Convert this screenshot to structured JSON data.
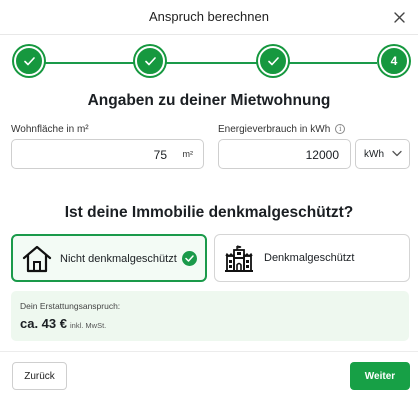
{
  "dialog": {
    "title": "Anspruch berechnen"
  },
  "stepper": {
    "steps": [
      {
        "state": "completed",
        "icon": "check-icon"
      },
      {
        "state": "completed",
        "icon": "check-icon"
      },
      {
        "state": "completed",
        "icon": "check-icon"
      },
      {
        "state": "current",
        "label": "4"
      }
    ],
    "accent_color": "#16983f"
  },
  "apartment_section": {
    "title": "Angaben zu deiner Mietwohnung",
    "living_area": {
      "label": "Wohnfläche in m²",
      "value": "75",
      "unit": "m²"
    },
    "energy_consumption": {
      "label": "Energieverbrauch in kWh",
      "info_icon": "info-icon",
      "value": "12000",
      "unit_selected": "kWh"
    }
  },
  "heritage_section": {
    "title": "Ist deine Immobilie denkmalgeschützt?",
    "options": [
      {
        "label": "Nicht denkmalgeschützt",
        "icon": "house-icon",
        "selected": true
      },
      {
        "label": "Denkmalgeschützt",
        "icon": "historic-building-icon",
        "selected": false
      }
    ]
  },
  "result": {
    "label": "Dein Erstattungsanspruch:",
    "amount": "ca. 43 €",
    "note": "inkl. MwSt."
  },
  "footer": {
    "back_label": "Zurück",
    "next_label": "Weiter"
  }
}
